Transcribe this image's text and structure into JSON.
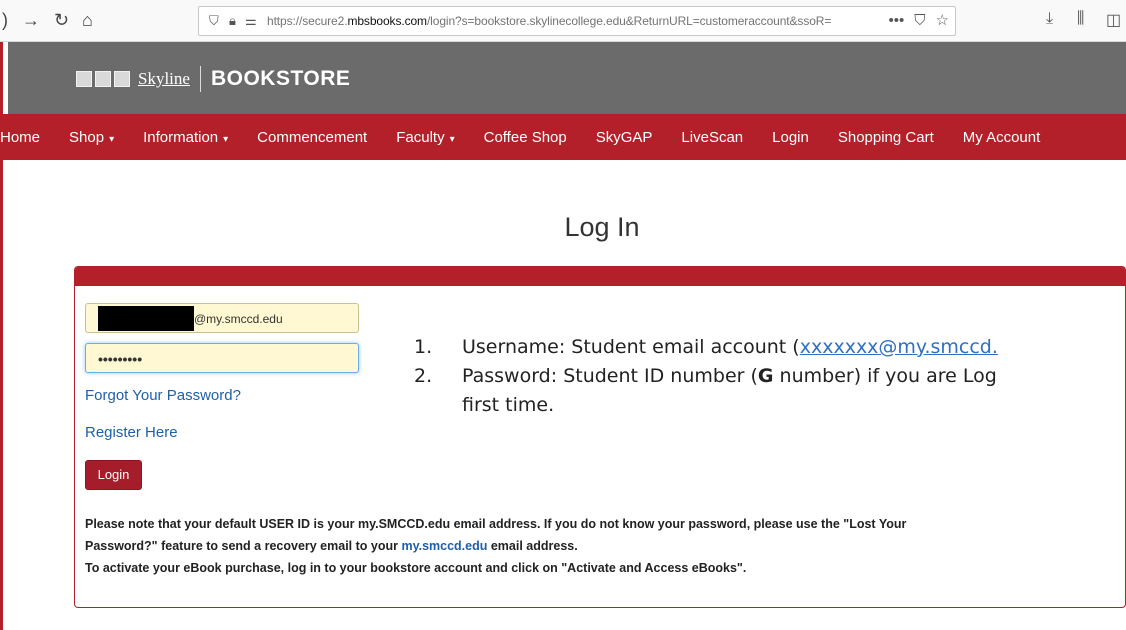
{
  "browser": {
    "url_prefix": "https://secure2.",
    "url_domain": "mbsbooks.com",
    "url_rest": "/login?s=bookstore.skylinecollege.edu&ReturnURL=customeraccount&ssoR=",
    "icons": [
      "back-arrow-icon",
      "forward-arrow-icon",
      "reload-icon",
      "home-icon",
      "shield-icon",
      "lock-icon",
      "more-icon",
      "pocket-icon",
      "star-icon",
      "download-icon",
      "library-icon",
      "sidebar-icon"
    ]
  },
  "header": {
    "logo_name": "Skyline",
    "logo_store": "BOOKSTORE"
  },
  "nav": {
    "items": [
      {
        "label": "Home",
        "caret": false
      },
      {
        "label": "Shop",
        "caret": true
      },
      {
        "label": "Information",
        "caret": true
      },
      {
        "label": "Commencement",
        "caret": false
      },
      {
        "label": "Faculty",
        "caret": true
      },
      {
        "label": "Coffee Shop",
        "caret": false
      },
      {
        "label": "SkyGAP",
        "caret": false
      },
      {
        "label": "LiveScan",
        "caret": false
      },
      {
        "label": "Login",
        "caret": false
      },
      {
        "label": "Shopping Cart",
        "caret": false
      },
      {
        "label": "My Account",
        "caret": false
      }
    ]
  },
  "main": {
    "title": "Log In",
    "username_suffix": "@my.smccd.edu",
    "password_mask": "•••••••••",
    "forgot_label": "Forgot Your Password?",
    "register_label": "Register Here",
    "login_button": "Login",
    "notice_line1": "Please note that your default USER ID is your my.SMCCD.edu email address. If you do not know your password, please use the \"Lost Your",
    "notice_line2_a": "Password?\" feature to send a recovery email to your ",
    "notice_line2_link": "my.smccd.edu",
    "notice_line2_b": " email address.",
    "notice_line3": "To activate your eBook purchase, log in to your bookstore account and click on \"Activate and Access eBooks\"."
  },
  "annotation": {
    "item1_num": "1.",
    "item1_text": "Username: Student email account (",
    "item1_link": "xxxxxxx@my.smccd.",
    "item2_num": "2.",
    "item2_text_a": "Password: Student ID number (",
    "item2_bold": "G",
    "item2_text_b": " number) if you are Log",
    "item2_cont": "first time."
  },
  "colors": {
    "brand_red": "#b3202a",
    "header_gray": "#6b6b6b",
    "link_blue": "#1f5fa8"
  }
}
